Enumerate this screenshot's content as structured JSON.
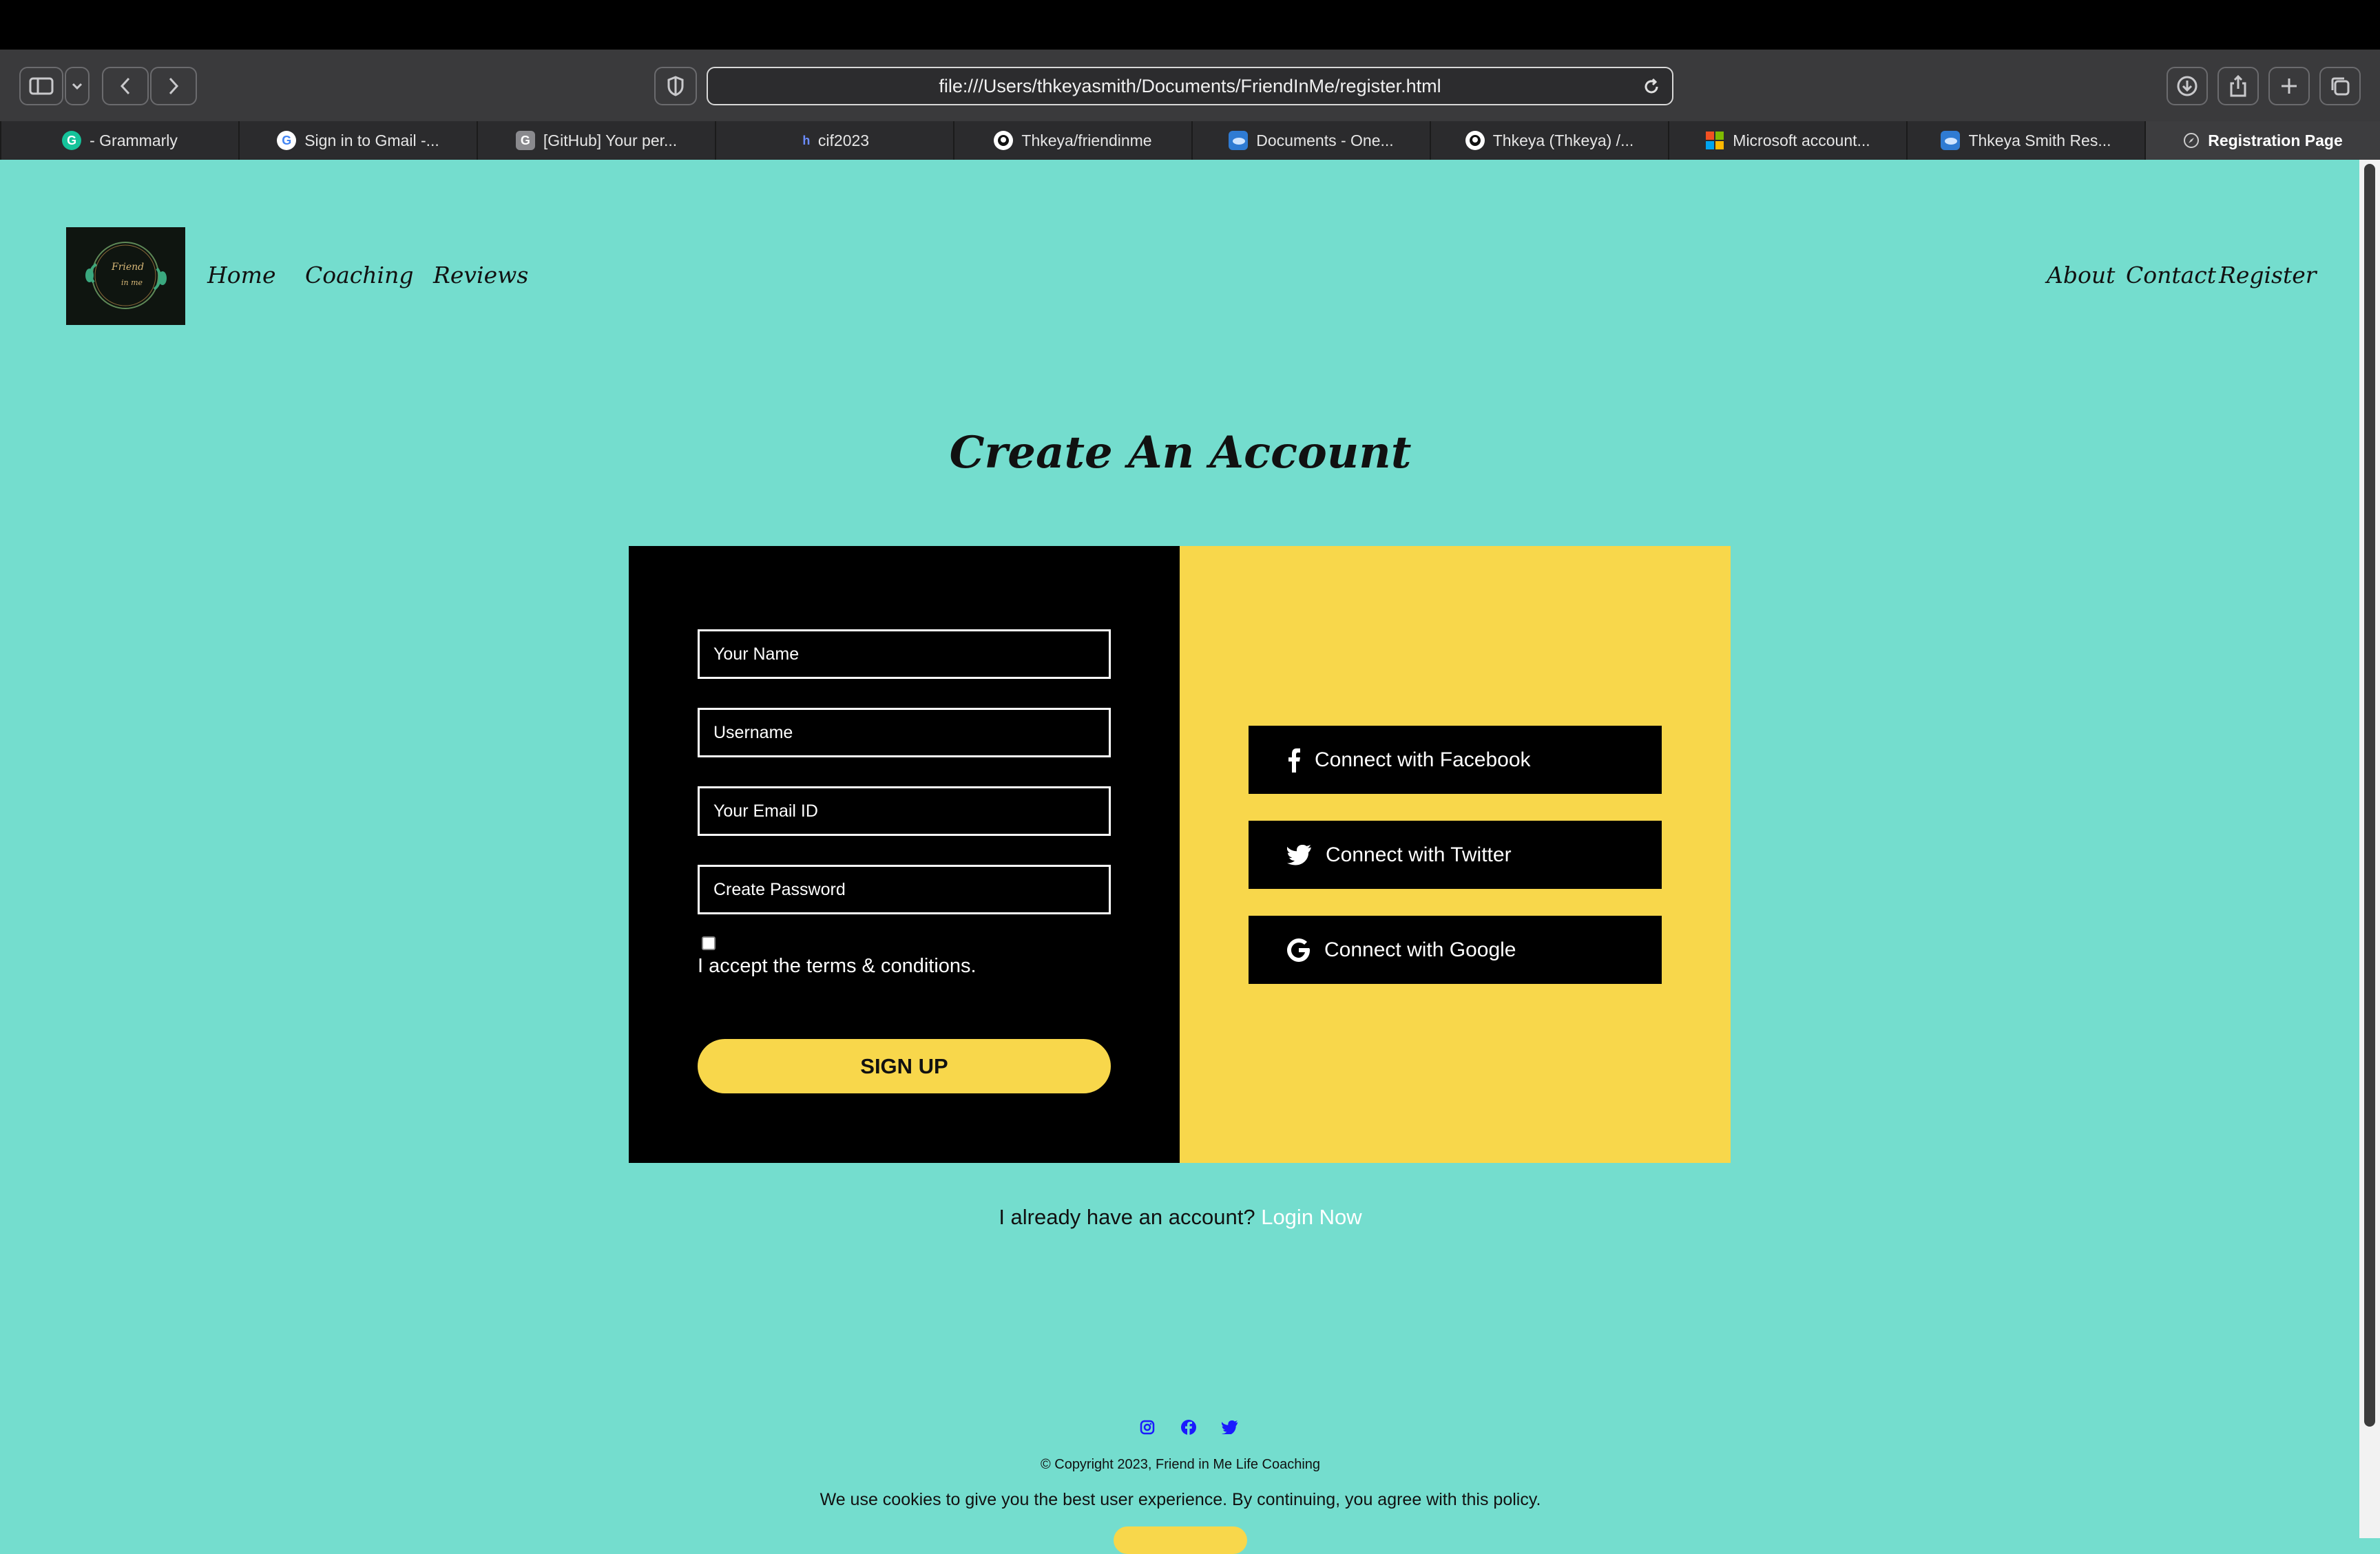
{
  "browser": {
    "url": "file:///Users/thkeyasmith/Documents/FriendInMe/register.html",
    "tabs": [
      {
        "label": "- Grammarly",
        "favicon": "grammarly-icon",
        "color": "#15c39a",
        "glyph": "G"
      },
      {
        "label": "Sign in to Gmail -...",
        "favicon": "google-icon",
        "color": "#ffffff",
        "glyph": "G"
      },
      {
        "label": "[GitHub] Your per...",
        "favicon": "gmail-g-icon",
        "color": "#8a8a8e",
        "glyph": "G"
      },
      {
        "label": "cif2023",
        "favicon": "h-icon",
        "color": "#2b2b2d",
        "glyph": "h"
      },
      {
        "label": "Thkeya/friendinme",
        "favicon": "github-icon",
        "color": "#ffffff",
        "glyph": ""
      },
      {
        "label": "Documents - One...",
        "favicon": "onedrive-icon",
        "color": "#2f7bd3",
        "glyph": ""
      },
      {
        "label": "Thkeya (Thkeya) /...",
        "favicon": "github-icon",
        "color": "#ffffff",
        "glyph": ""
      },
      {
        "label": "Microsoft account...",
        "favicon": "microsoft-icon",
        "color": "#f25022",
        "glyph": ""
      },
      {
        "label": "Thkeya Smith Res...",
        "favicon": "onedrive-icon",
        "color": "#2f7bd3",
        "glyph": ""
      },
      {
        "label": "Registration Page",
        "favicon": "compass-icon",
        "color": "#3d3d3f",
        "glyph": "",
        "active": true
      }
    ]
  },
  "nav": {
    "left": [
      "Home",
      "Coaching",
      "Reviews"
    ],
    "right": [
      "About",
      "Contact",
      "Register"
    ],
    "logo_text": "Friend in me"
  },
  "page": {
    "title": "Create An Account"
  },
  "form": {
    "name_placeholder": "Your Name",
    "username_placeholder": "Username",
    "email_placeholder": "Your Email ID",
    "password_placeholder": "Create Password",
    "terms_label": "I accept the terms & conditions.",
    "signup_label": "SIGN UP"
  },
  "social": {
    "facebook": "Connect with Facebook",
    "twitter": "Connect with Twitter",
    "google": "Connect with Google"
  },
  "footer": {
    "already": "I already have an account?",
    "login_link": "Login Now",
    "copyright": "© Copyright 2023, Friend in Me Life Coaching",
    "cookie_notice": "We use cookies to give you the best user experience. By continuing, you agree with this policy."
  },
  "colors": {
    "page_bg": "#74ddce",
    "accent_yellow": "#f8d74b",
    "panel_black": "#000000",
    "social_icon_blue": "#1a1aff"
  }
}
